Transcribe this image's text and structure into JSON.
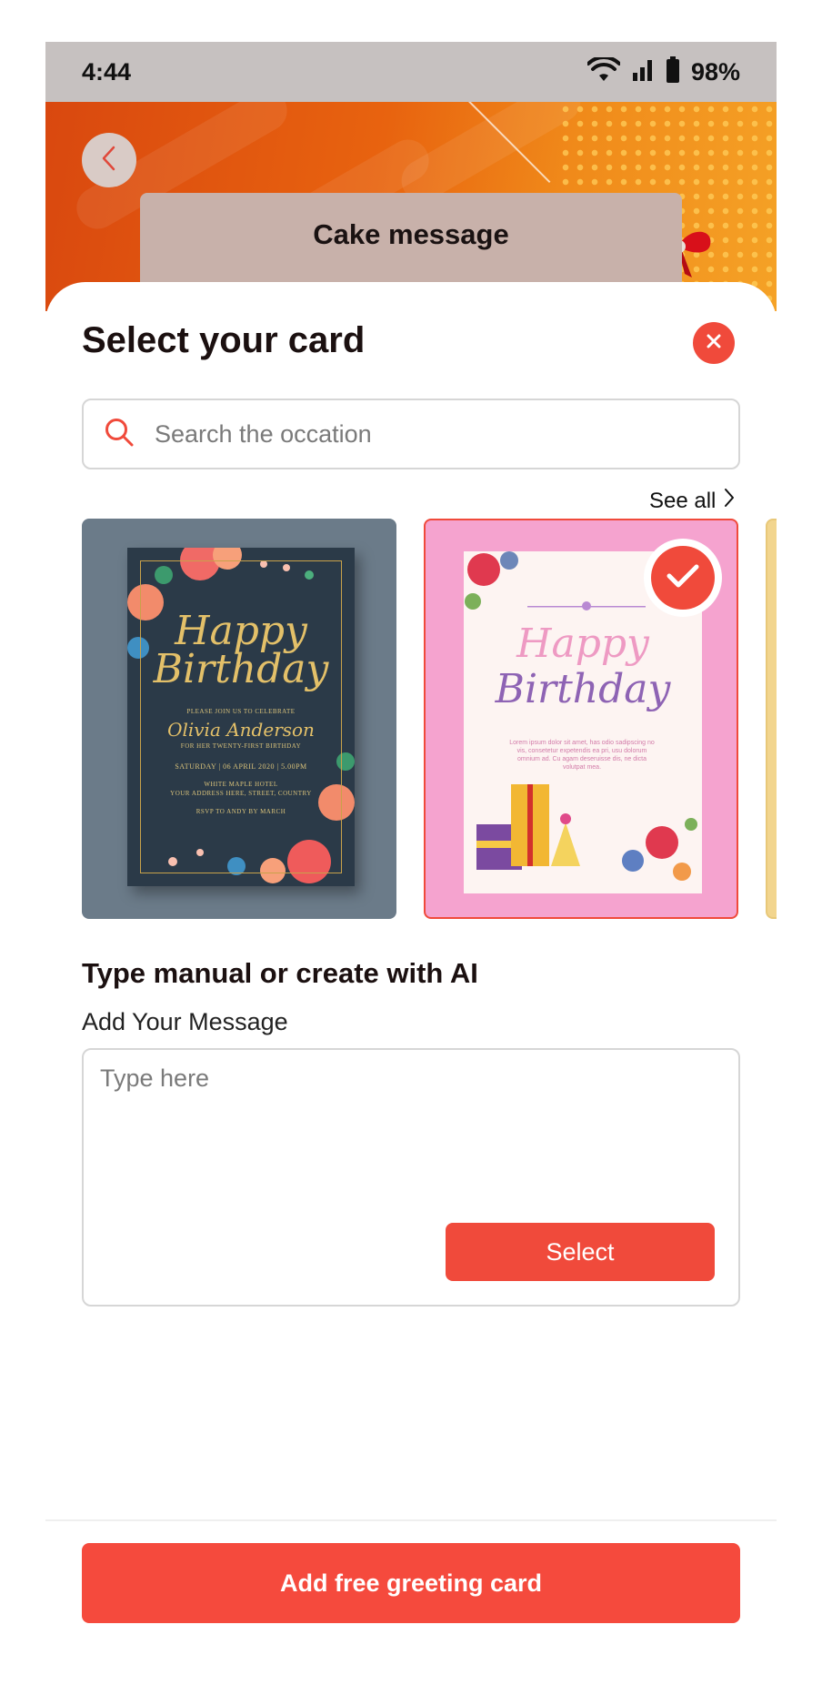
{
  "status_bar": {
    "time": "4:44",
    "battery": "98%",
    "icons": [
      "wifi-icon",
      "signal-icon",
      "battery-icon"
    ]
  },
  "header": {
    "back_icon": "chevron-left-icon",
    "title": "Cake message"
  },
  "sheet": {
    "title": "Select your card",
    "close_icon": "close-icon"
  },
  "search": {
    "placeholder": "Search the occation",
    "value": "",
    "icon": "search-icon"
  },
  "see_all": {
    "label": "See all",
    "icon": "chevron-right-icon"
  },
  "cards": [
    {
      "selected": false,
      "happy": "Happy",
      "birthday": "Birthday",
      "line1": "PLEASE JOIN US TO CELEBRATE",
      "name": "Olivia Anderson",
      "line2": "FOR HER TWENTY-FIRST BIRTHDAY",
      "date": "SATURDAY | 06 APRIL 2020 | 5.00PM",
      "address1": "WHITE MAPLE HOTEL",
      "address2": "YOUR ADDRESS HERE, STREET, COUNTRY",
      "rsvp": "RSVP TO ANDY BY MARCH"
    },
    {
      "selected": true,
      "happy": "Happy",
      "birthday": "Birthday",
      "body": "Lorem ipsum dolor sit amet, has odio sadipscing no vis, consetetur expetendis ea pri, usu dolorum omnium ad. Cu agam deseruisse dis, ne dicta volutpat mea."
    },
    {
      "selected": false
    }
  ],
  "compose": {
    "section_title": "Type manual or create with AI",
    "label": "Add Your Message",
    "placeholder": "Type here",
    "value": "",
    "select_label": "Select"
  },
  "footer": {
    "primary_label": "Add free greeting card"
  },
  "colors": {
    "accent": "#f04a3b",
    "primary_button": "#f54a3d",
    "banner": "#e8630f",
    "selected_card_bg": "#f5a3cf"
  }
}
